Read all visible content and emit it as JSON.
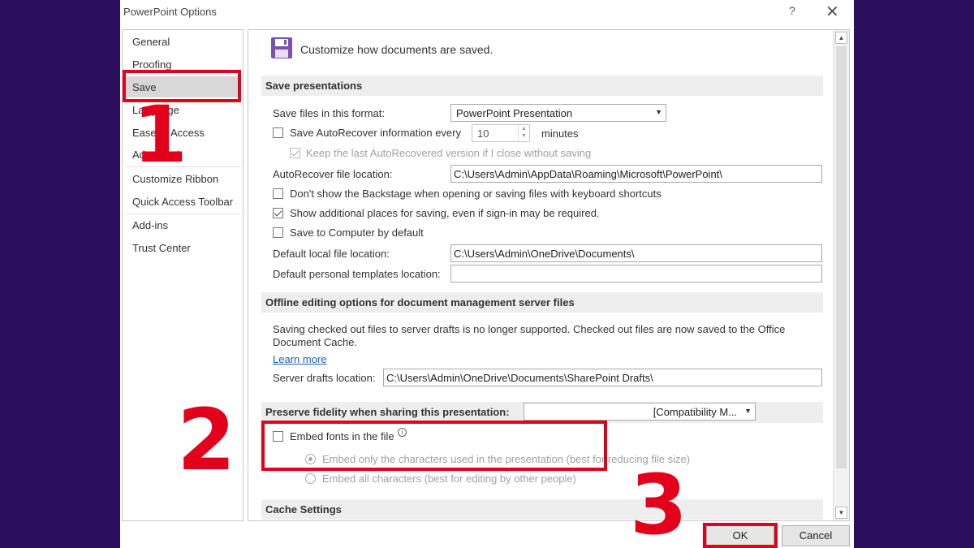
{
  "window": {
    "title": "PowerPoint Options",
    "help": "?",
    "close": "✕"
  },
  "nav": {
    "items": [
      {
        "label": "General"
      },
      {
        "label": "Proofing"
      },
      {
        "label": "Save"
      },
      {
        "label": "Language"
      },
      {
        "label": "Ease of Access"
      },
      {
        "label": "Advanced"
      },
      {
        "label": "Customize Ribbon"
      },
      {
        "label": "Quick Access Toolbar"
      },
      {
        "label": "Add-ins"
      },
      {
        "label": "Trust Center"
      }
    ],
    "selected": "Save"
  },
  "header": {
    "text": "Customize how documents are saved.",
    "icon": "floppy-disk-icon"
  },
  "save_presentations": {
    "title": "Save presentations",
    "format_label": "Save files in this format:",
    "format_value": "PowerPoint Presentation",
    "autorecover_label": "Save AutoRecover information every",
    "autorecover_checked": false,
    "autorecover_minutes": "10",
    "minutes_label": "minutes",
    "keep_last_label": "Keep the last AutoRecovered version if I close without saving",
    "keep_last_checked": true,
    "autorecover_location_label": "AutoRecover file location:",
    "autorecover_location_value": "C:\\Users\\Admin\\AppData\\Roaming\\Microsoft\\PowerPoint\\",
    "dont_show_backstage_label": "Don't show the Backstage when opening or saving files with keyboard shortcuts",
    "dont_show_backstage_checked": false,
    "show_additional_label": "Show additional places for saving, even if sign-in may be required.",
    "show_additional_checked": true,
    "save_to_computer_label": "Save to Computer by default",
    "save_to_computer_checked": false,
    "default_local_label": "Default local file location:",
    "default_local_value": "C:\\Users\\Admin\\OneDrive\\Documents\\",
    "default_templates_label": "Default personal templates location:",
    "default_templates_value": ""
  },
  "offline": {
    "title": "Offline editing options for document management server files",
    "description_line1": "Saving checked out files to server drafts is no longer supported. Checked out files are now saved to the Office",
    "description_line2": "Document Cache.",
    "learn_more": "Learn more",
    "drafts_label": "Server drafts location:",
    "drafts_value": "C:\\Users\\Admin\\OneDrive\\Documents\\SharePoint Drafts\\"
  },
  "fidelity": {
    "title": "Preserve fidelity when sharing this presentation:",
    "presentation_value": "[Compatibility M...",
    "embed_fonts_label": "Embed fonts in the file",
    "embed_fonts_checked": false,
    "info_icon": "info-icon",
    "embed_only_label": "Embed only the characters used in the presentation (best for reducing file size)",
    "embed_all_label": "Embed all characters (best for editing by other people)"
  },
  "cache": {
    "title": "Cache Settings"
  },
  "buttons": {
    "ok": "OK",
    "cancel": "Cancel"
  },
  "annotations": {
    "step1": "1",
    "step2": "2",
    "step3": "3",
    "color": "#e3001b"
  }
}
